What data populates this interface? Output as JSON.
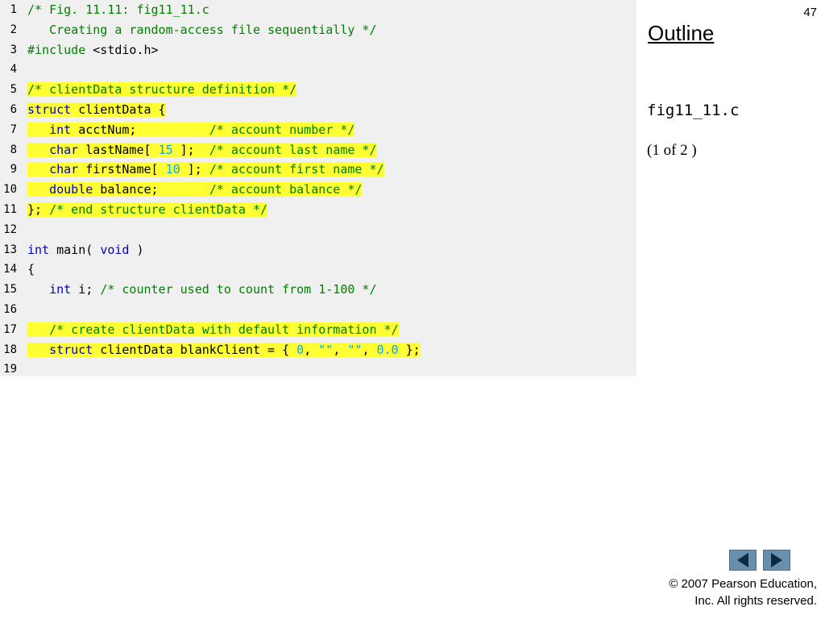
{
  "slide_number": "47",
  "sidebar": {
    "outline_label": "Outline",
    "filename": "fig11_11.c",
    "page_indicator": "(1 of 2 )"
  },
  "copyright": {
    "line1": "© 2007 Pearson Education,",
    "line2": "Inc.  All rights reserved."
  },
  "navigation": {
    "prev_icon": "left-arrow-icon",
    "next_icon": "right-arrow-icon",
    "button_color": "#6a8fad"
  },
  "code": {
    "colors": {
      "comment": "#008000",
      "keyword": "#0000cc",
      "number": "#00aaee",
      "default": "#000000",
      "highlight": "#ffff33"
    },
    "lines": [
      {
        "n": "1",
        "hl": false,
        "segs": [
          [
            "c",
            "/* Fig. 11.11: fig11_11.c"
          ]
        ]
      },
      {
        "n": "2",
        "hl": false,
        "segs": [
          [
            "c",
            "   Creating a random-access file sequentially */"
          ]
        ]
      },
      {
        "n": "3",
        "hl": false,
        "segs": [
          [
            "c",
            "#include "
          ],
          [
            "d",
            "<stdio.h>"
          ]
        ]
      },
      {
        "n": "4",
        "hl": false,
        "segs": []
      },
      {
        "n": "5",
        "hl": true,
        "segs": [
          [
            "c",
            "/* clientData structure definition */"
          ]
        ]
      },
      {
        "n": "6",
        "hl": true,
        "segs": [
          [
            "k",
            "struct"
          ],
          [
            "d",
            " clientData {"
          ]
        ]
      },
      {
        "n": "7",
        "hl": true,
        "segs": [
          [
            "d",
            "   "
          ],
          [
            "k",
            "int"
          ],
          [
            "d",
            " acctNum;          "
          ],
          [
            "c",
            "/* account number */"
          ]
        ]
      },
      {
        "n": "8",
        "hl": true,
        "segs": [
          [
            "d",
            "   "
          ],
          [
            "k",
            "char"
          ],
          [
            "d",
            " lastName[ "
          ],
          [
            "n",
            "15"
          ],
          [
            "d",
            " ];  "
          ],
          [
            "c",
            "/* account last name */"
          ]
        ]
      },
      {
        "n": "9",
        "hl": true,
        "segs": [
          [
            "d",
            "   "
          ],
          [
            "k",
            "char"
          ],
          [
            "d",
            " firstName[ "
          ],
          [
            "n",
            "10"
          ],
          [
            "d",
            " ]; "
          ],
          [
            "c",
            "/* account first name */"
          ]
        ]
      },
      {
        "n": "10",
        "hl": true,
        "segs": [
          [
            "d",
            "   "
          ],
          [
            "k",
            "double"
          ],
          [
            "d",
            " balance;       "
          ],
          [
            "c",
            "/* account balance */"
          ]
        ]
      },
      {
        "n": "11",
        "hl": true,
        "segs": [
          [
            "d",
            "}; "
          ],
          [
            "c",
            "/* end structure clientData */"
          ]
        ]
      },
      {
        "n": "12",
        "hl": false,
        "segs": []
      },
      {
        "n": "13",
        "hl": false,
        "segs": [
          [
            "k",
            "int"
          ],
          [
            "d",
            " main( "
          ],
          [
            "k",
            "void"
          ],
          [
            "d",
            " )"
          ]
        ]
      },
      {
        "n": "14",
        "hl": false,
        "segs": [
          [
            "d",
            "{"
          ]
        ]
      },
      {
        "n": "15",
        "hl": false,
        "segs": [
          [
            "d",
            "   "
          ],
          [
            "k",
            "int"
          ],
          [
            "d",
            " i; "
          ],
          [
            "c",
            "/* counter used to count from 1-100 */"
          ]
        ]
      },
      {
        "n": "16",
        "hl": false,
        "segs": []
      },
      {
        "n": "17",
        "hl": true,
        "segs": [
          [
            "d",
            "   "
          ],
          [
            "c",
            "/* create clientData with default information */"
          ]
        ]
      },
      {
        "n": "18",
        "hl": true,
        "segs": [
          [
            "d",
            "   "
          ],
          [
            "k",
            "struct"
          ],
          [
            "d",
            " clientData blankClient = { "
          ],
          [
            "n",
            "0"
          ],
          [
            "d",
            ", "
          ],
          [
            "n",
            "\"\""
          ],
          [
            "d",
            ", "
          ],
          [
            "n",
            "\"\""
          ],
          [
            "d",
            ", "
          ],
          [
            "n",
            "0.0"
          ],
          [
            "d",
            " };"
          ]
        ]
      },
      {
        "n": "19",
        "hl": false,
        "segs": []
      }
    ]
  }
}
